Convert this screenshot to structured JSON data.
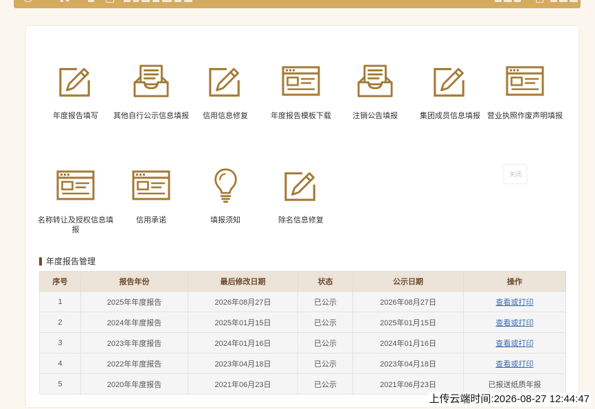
{
  "colors": {
    "accent": "#a47a33",
    "page_background": "#fbf7ef",
    "header_bar": "#d5ab60",
    "table_header_bg": "#ece3d9",
    "table_header_text": "#6f4b2b",
    "link": "#3e6db3",
    "section_marker": "#7a4a1f"
  },
  "menu": {
    "items": [
      {
        "label": "年度报告填写",
        "icon": "edit-icon"
      },
      {
        "label": "其他自行公示信息填报",
        "icon": "inbox-tray-icon"
      },
      {
        "label": "信用信息修复",
        "icon": "edit-icon"
      },
      {
        "label": "年度报告模板下载",
        "icon": "window-form-icon"
      },
      {
        "label": "注销公告填报",
        "icon": "inbox-tray-icon"
      },
      {
        "label": "集团成员信息填报",
        "icon": "edit-icon"
      },
      {
        "label": "营业执照作废声明填报",
        "icon": "window-form-icon"
      },
      {
        "label": "名称转让及授权信息填报",
        "icon": "window-form-icon"
      },
      {
        "label": "信用承诺",
        "icon": "window-form-icon"
      },
      {
        "label": "填报须知",
        "icon": "lightbulb-icon"
      },
      {
        "label": "除名信息修复",
        "icon": "edit-icon"
      }
    ],
    "close_label": "关闭"
  },
  "annual_report": {
    "section_title": "年度报告管理",
    "columns": [
      "序号",
      "报告年份",
      "最后修改日期",
      "状态",
      "公示日期",
      "操作"
    ],
    "rows": [
      {
        "index": 1,
        "year": "2025年年度报告",
        "modified": "2026年08月27日",
        "status": "已公示",
        "published": "2026年08月27日",
        "action": "查看或打印"
      },
      {
        "index": 2,
        "year": "2024年年度报告",
        "modified": "2025年01月15日",
        "status": "已公示",
        "published": "2025年01月15日",
        "action": "查看或打印"
      },
      {
        "index": 3,
        "year": "2023年年度报告",
        "modified": "2024年01月16日",
        "status": "已公示",
        "published": "2024年01月16日",
        "action": "查看或打印"
      },
      {
        "index": 4,
        "year": "2022年年度报告",
        "modified": "2023年04月18日",
        "status": "已公示",
        "published": "2023年04月18日",
        "action": "查看或打印"
      },
      {
        "index": 5,
        "year": "2020年年度报告",
        "modified": "2021年06月23日",
        "status": "已公示",
        "published": "2021年06月23日",
        "action": "已报送纸质年报"
      }
    ]
  },
  "upload_timestamp": "上传云端时间:2026-08-27 12:44:47"
}
